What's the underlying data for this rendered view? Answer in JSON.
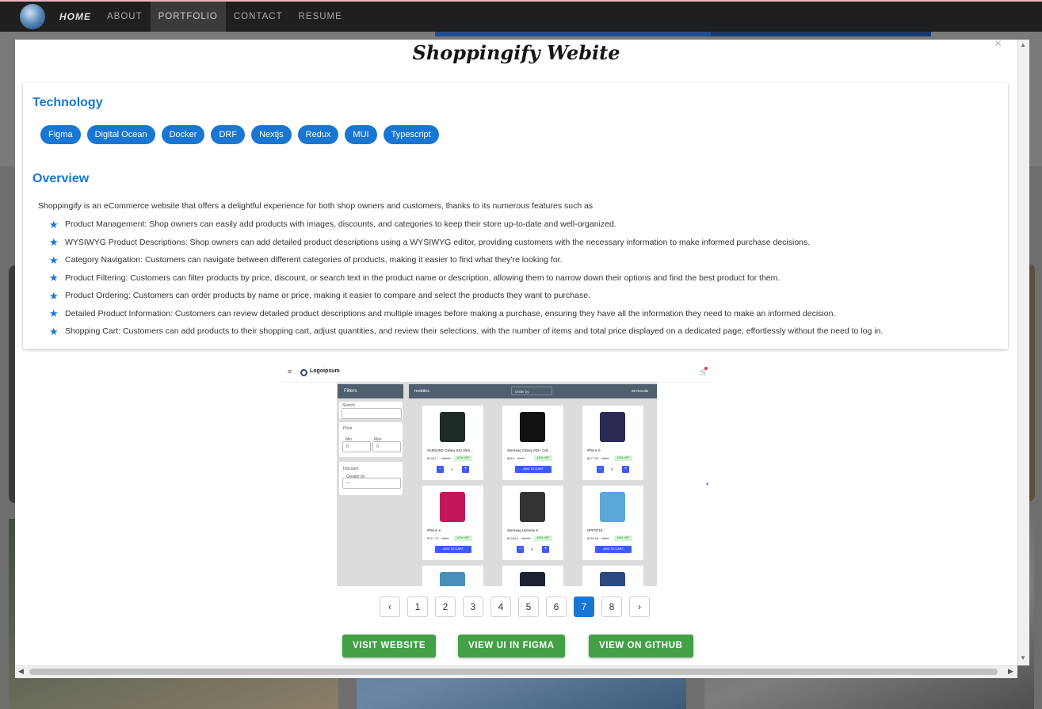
{
  "nav": {
    "home": "HOME",
    "items": [
      "ABOUT",
      "PORTFOLIO",
      "CONTACT",
      "RESUME"
    ]
  },
  "modal": {
    "title": "Shoppingify Webite",
    "close": "×",
    "technology_title": "Technology",
    "technologies": [
      "Figma",
      "Digital Ocean",
      "Docker",
      "DRF",
      "Nextjs",
      "Redux",
      "MUI",
      "Typescript"
    ],
    "overview_title": "Overview",
    "intro": "Shoppingify is an eCommerce website that offers a delightful experience for both shop owners and customers, thanks to its numerous features such as",
    "features": [
      "Product Management: Shop owners can easily add products with images, discounts, and categories to keep their store up-to-date and well-organized.",
      "WYSIWYG Product Descriptions: Shop owners can add detailed product descriptions using a WYSIWYG editor, providing customers with the necessary information to make informed purchase decisions.",
      "Category Navigation: Customers can navigate between different categories of products, making it easier to find what they're looking for.",
      "Product Filtering: Customers can filter products by price, discount, or search text in the product name or description, allowing them to narrow down their options and find the best product for them.",
      "Product Ordering: Customers can order products by name or price, making it easier to compare and select the products they want to purchase.",
      "Detailed Product Information: Customers can review detailed product descriptions and multiple images before making a purchase, ensuring they have all the information they need to make an informed decision.",
      "Shopping Cart: Customers can add products to their shopping cart, adjust quantities, and review their selections, with the number of items and total price displayed on a dedicated page, effortlessly without the need to log in."
    ],
    "screenshot": {
      "menu": "≡",
      "logo": "Logoipsum",
      "cart": "🛒",
      "filters_title": "Filters",
      "search_label": "Search",
      "price_label": "Price",
      "min_label": "Min",
      "min_value": "0",
      "max_label": "Max",
      "max_value": "0",
      "discount_label": "Discount",
      "discount_select_label": "Greater by",
      "discount_select_value": "—",
      "category": "mobiles",
      "order_by": "Order by",
      "results": "26 Results",
      "products": [
        {
          "name": "SAMSUNG Galaxy S22 Ultra ...",
          "price": "$1341.7",
          "old": "$1699",
          "off": "10% OFF",
          "mode": "stepper",
          "qty": "1",
          "color": "#1e2a25"
        },
        {
          "name": "Samsung Galaxy S22+ Cell...",
          "price": "$819",
          "old": "$949",
          "off": "14% OFF",
          "mode": "cart",
          "qty": "",
          "color": "#111111"
        },
        {
          "name": "iPhone 9",
          "price": "$477.05",
          "old": "$549",
          "off": "13% OFF",
          "mode": "stepper",
          "qty": "2",
          "color": "#2a2a55"
        },
        {
          "name": "iPhone X",
          "price": "$717.73",
          "old": "$899",
          "off": "10% OFF",
          "mode": "cart",
          "qty": "",
          "color": "#c2185b"
        },
        {
          "name": "Samsung Universe 9",
          "price": "$1249.9",
          "old": "$1499",
          "off": "15% OFF",
          "mode": "stepper",
          "qty": "2",
          "color": "#333333"
        },
        {
          "name": "OPPOF19",
          "price": "$253.65",
          "old": "$280",
          "off": "18% OFF",
          "mode": "cart",
          "qty": "",
          "color": "#5aa7d8"
        },
        {
          "name": "",
          "price": "",
          "old": "",
          "off": "",
          "mode": "none",
          "qty": "",
          "color": "#4a8fb8"
        },
        {
          "name": "",
          "price": "",
          "old": "",
          "off": "",
          "mode": "none",
          "qty": "",
          "color": "#1a2233"
        },
        {
          "name": "",
          "price": "",
          "old": "",
          "off": "",
          "mode": "none",
          "qty": "",
          "color": "#2b4a80"
        }
      ],
      "add_to_cart": "ADD TO CART",
      "minus": "−",
      "plus": "+"
    },
    "pagination": {
      "prev": "‹",
      "next": "›",
      "pages": [
        "1",
        "2",
        "3",
        "4",
        "5",
        "6",
        "7",
        "8"
      ],
      "current": "7"
    },
    "buttons": {
      "visit": "VISIT WEBSITE",
      "figma": "VIEW UI IN FIGMA",
      "github": "VIEW ON GITHUB"
    }
  },
  "colors": {
    "accent": "#1976d2",
    "action": "#43a047",
    "navbar": "#1f1f1f"
  }
}
